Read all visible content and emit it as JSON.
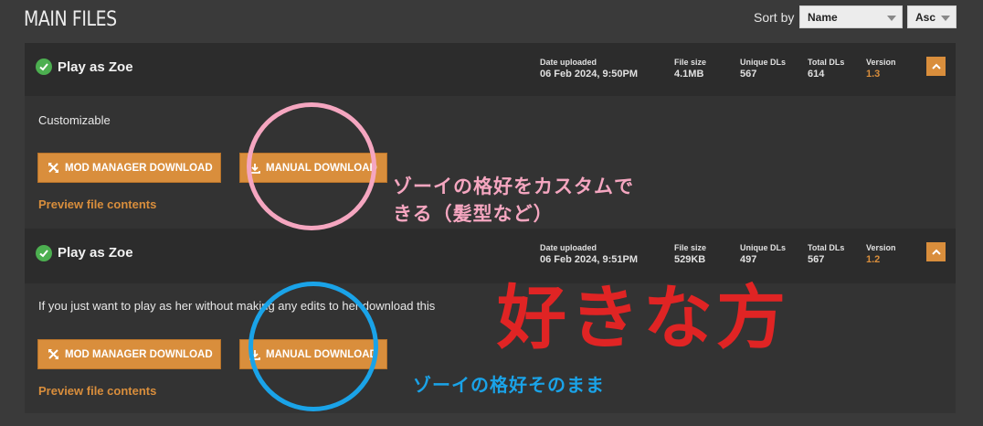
{
  "section": {
    "title": "MAIN FILES"
  },
  "sort": {
    "label": "Sort by",
    "field_selected": "Name",
    "order_selected": "Asc"
  },
  "files": [
    {
      "name": "Play as Zoe",
      "date_label": "Date uploaded",
      "date_value": "06 Feb 2024, 9:50PM",
      "size_label": "File size",
      "size_value": "4.1MB",
      "unique_label": "Unique DLs",
      "unique_value": "567",
      "total_label": "Total DLs",
      "total_value": "614",
      "version_label": "Version",
      "version_value": "1.3",
      "description": "Customizable",
      "mod_manager_label": "MOD MANAGER DOWNLOAD",
      "manual_label": "MANUAL DOWNLOAD",
      "preview_label": "Preview file contents"
    },
    {
      "name": "Play as Zoe",
      "date_label": "Date uploaded",
      "date_value": "06 Feb 2024, 9:51PM",
      "size_label": "File size",
      "size_value": "529KB",
      "unique_label": "Unique DLs",
      "unique_value": "497",
      "total_label": "Total DLs",
      "total_value": "567",
      "version_label": "Version",
      "version_value": "1.2",
      "description": "If you just want to play as her without making any edits to her download this",
      "mod_manager_label": "MOD MANAGER DOWNLOAD",
      "manual_label": "MANUAL DOWNLOAD",
      "preview_label": "Preview file contents"
    }
  ],
  "annotations": {
    "note1_line1": "ゾーイの格好をカスタムで",
    "note1_line2": "きる（髪型など）",
    "note2": "ゾーイの格好そのまま",
    "big_note": "好きな方",
    "pink": "#f5a6c0",
    "blue": "#1aa3e8",
    "red": "#e02424"
  },
  "colors": {
    "accent": "#d98e3c",
    "check": "#4caf50"
  }
}
